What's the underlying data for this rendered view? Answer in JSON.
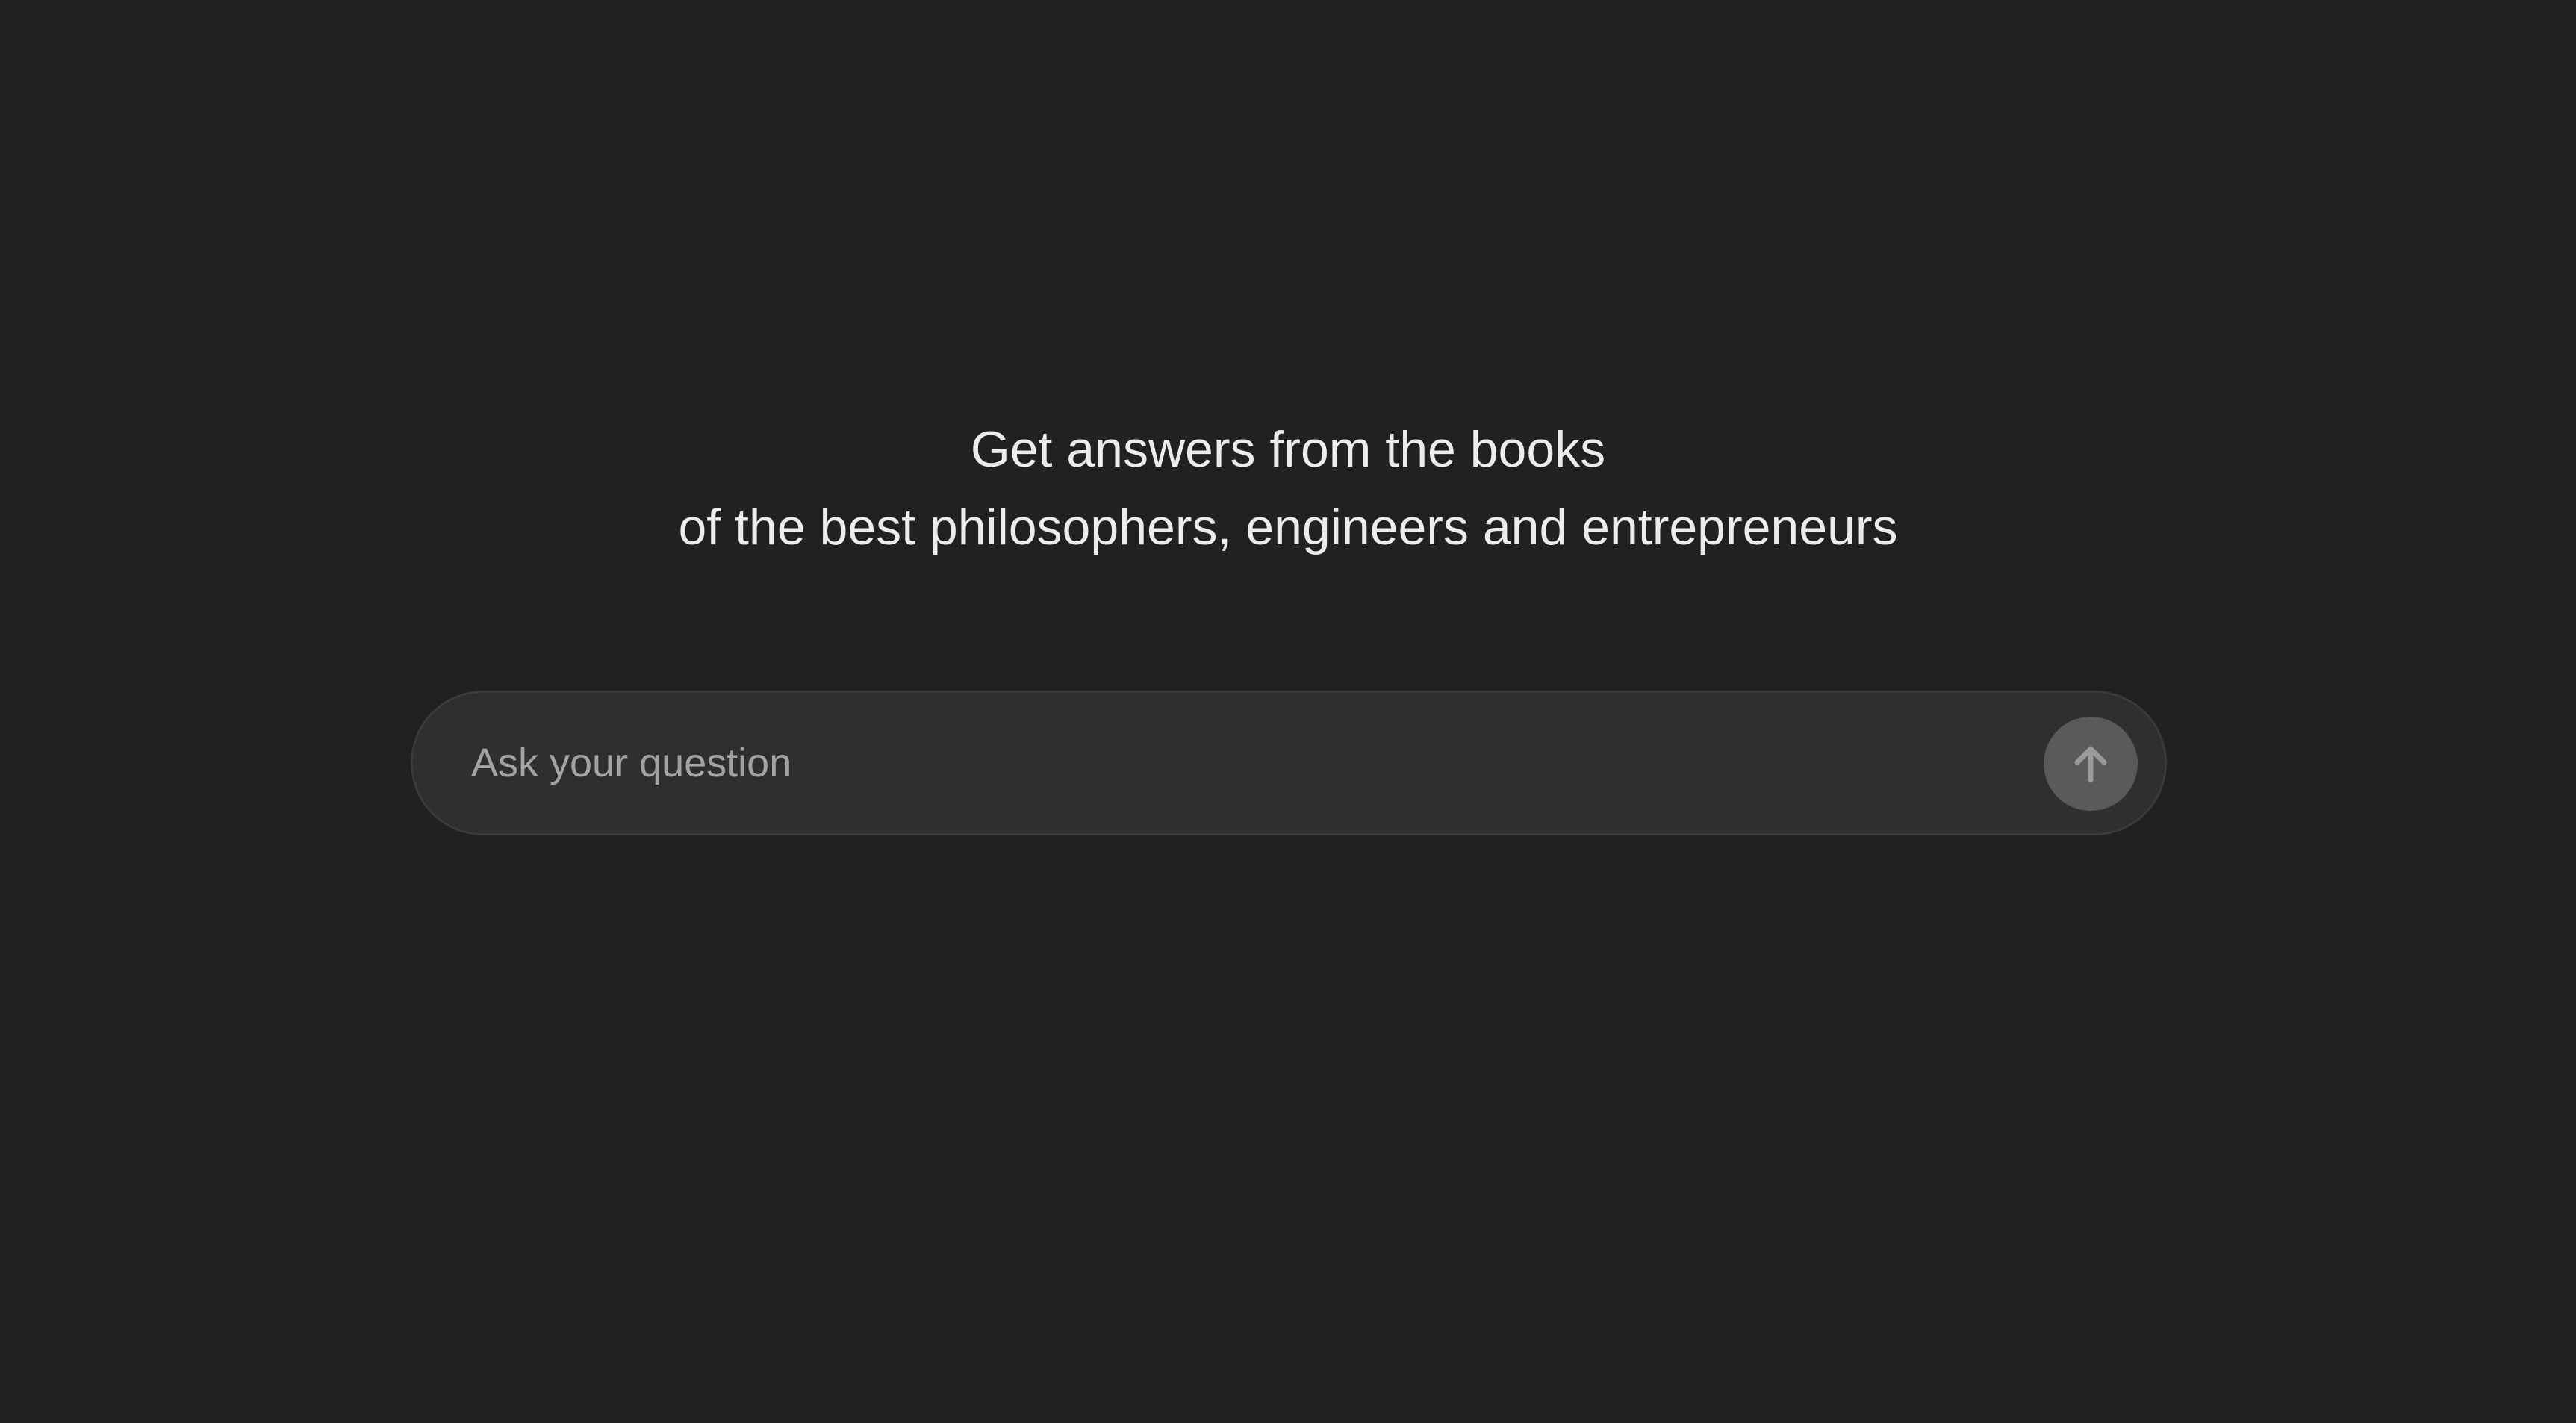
{
  "hero": {
    "line1": "Get answers from the books",
    "line2": "of the best philosophers, engineers and entrepreneurs"
  },
  "composer": {
    "placeholder": "Ask your question",
    "value": "",
    "send_icon": "arrow-up-icon"
  },
  "colors": {
    "background": "#212121",
    "input_background": "#2f2f2f",
    "send_button": "#5a5a5a",
    "text": "#ececec",
    "placeholder": "#a3a3a3"
  }
}
